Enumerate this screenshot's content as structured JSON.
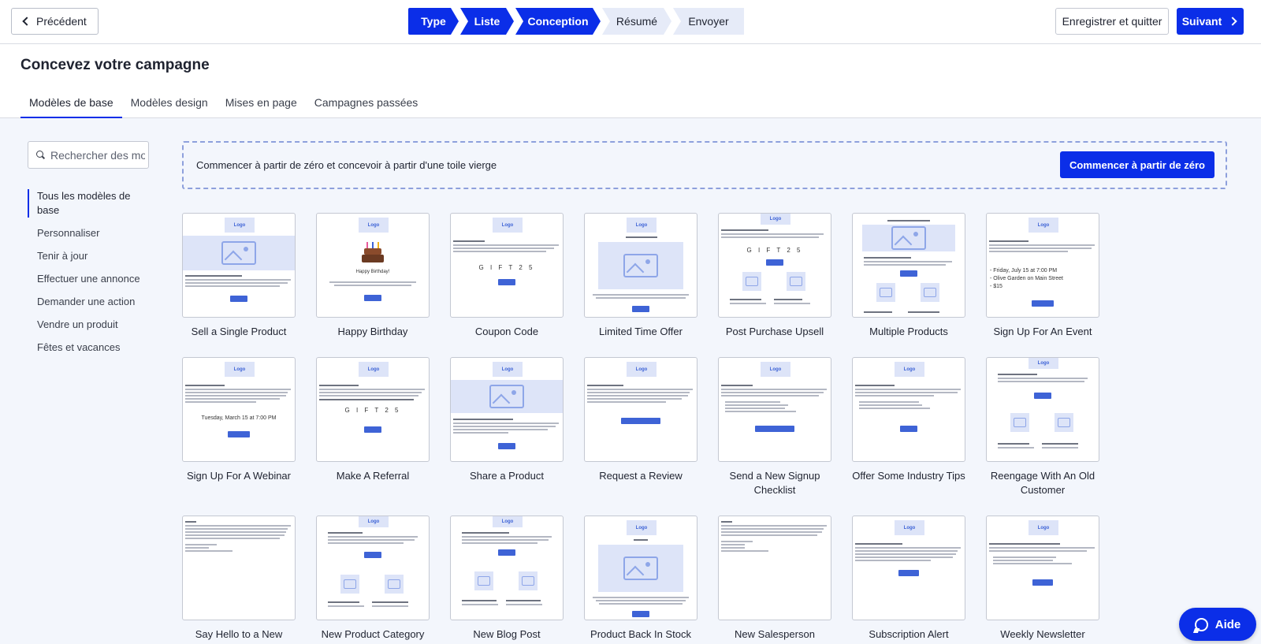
{
  "topbar": {
    "prev_label": "Précédent",
    "steps": [
      "Type",
      "Liste",
      "Conception",
      "Résumé",
      "Envoyer"
    ],
    "active_step": "Conception",
    "save_label": "Enregistrer et quitter",
    "next_label": "Suivant"
  },
  "header": {
    "title": "Concevez votre campagne",
    "tabs": [
      "Modèles de base",
      "Modèles design",
      "Mises en page",
      "Campagnes passées"
    ],
    "active_tab": "Modèles de base"
  },
  "sidebar": {
    "search_placeholder": "Rechercher des modèles",
    "categories": [
      "Tous les modèles de base",
      "Personnaliser",
      "Tenir à jour",
      "Effectuer une annonce",
      "Demander une action",
      "Vendre un produit",
      "Fêtes et vacances"
    ],
    "active_category": "Tous les modèles de base"
  },
  "blank_canvas": {
    "text": "Commencer à partir de zéro et concevoir à partir d'une toile vierge",
    "button_label": "Commencer à partir de zéro"
  },
  "thumbnail_texts": {
    "logo": "Logo",
    "coupon": "G I F T 2 5",
    "birthday": "Happy Birthday!",
    "event_details": [
      "- Friday, July 15 at 7:00 PM",
      "- Olive Garden on Main Street",
      "- $15"
    ],
    "webinar_date": "Tuesday, March 15 at 7:00 PM"
  },
  "templates": [
    "Sell a Single Product",
    "Happy Birthday",
    "Coupon Code",
    "Limited Time Offer",
    "Post Purchase Upsell",
    "Multiple Products",
    "Sign Up For An Event",
    "Sign Up For A Webinar",
    "Make A Referral",
    "Share a Product",
    "Request a Review",
    "Send a New Signup Checklist",
    "Offer Some Industry Tips",
    "Reengage With An Old Customer",
    "Say Hello to a New",
    "New Product Category",
    "New Blog Post",
    "Product Back In Stock",
    "New Salesperson",
    "Subscription Alert",
    "Weekly Newsletter"
  ],
  "help_label": "Aide",
  "colors": {
    "accent": "#0b2ee8",
    "placeholder_fill": "#dde4f8",
    "background": "#f3f6fc"
  }
}
